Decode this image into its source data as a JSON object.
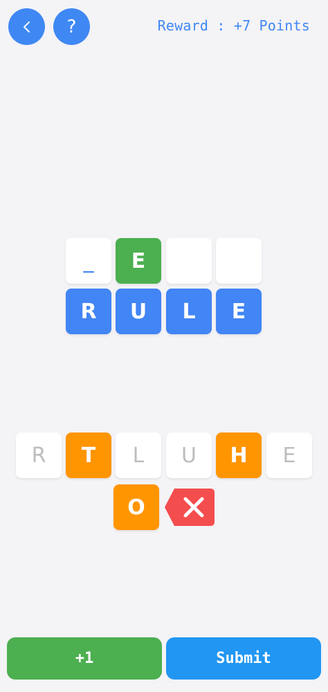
{
  "header": {
    "reward_text": "Reward : +7 Points",
    "back_icon": "chevron-left-icon",
    "help_label": "?"
  },
  "answer_row": [
    {
      "letter": "_",
      "state": "blank"
    },
    {
      "letter": "E",
      "state": "correct"
    },
    {
      "letter": "",
      "state": "empty"
    },
    {
      "letter": "",
      "state": "empty"
    }
  ],
  "target_word": [
    "R",
    "U",
    "L",
    "E"
  ],
  "letter_bank": {
    "row1": [
      {
        "letter": "R",
        "state": "used"
      },
      {
        "letter": "T",
        "state": "available"
      },
      {
        "letter": "L",
        "state": "used"
      },
      {
        "letter": "U",
        "state": "used"
      },
      {
        "letter": "H",
        "state": "available"
      },
      {
        "letter": "E",
        "state": "used"
      }
    ],
    "row2": [
      {
        "letter": "O",
        "state": "available"
      }
    ]
  },
  "footer": {
    "plus_label": "+1",
    "submit_label": "Submit"
  },
  "colors": {
    "background": "#f4f3f6",
    "blue": "#4285f4",
    "green": "#4caf50",
    "orange": "#ff9500",
    "delete_red": "#f44d4d",
    "submit_blue": "#2196f3"
  }
}
